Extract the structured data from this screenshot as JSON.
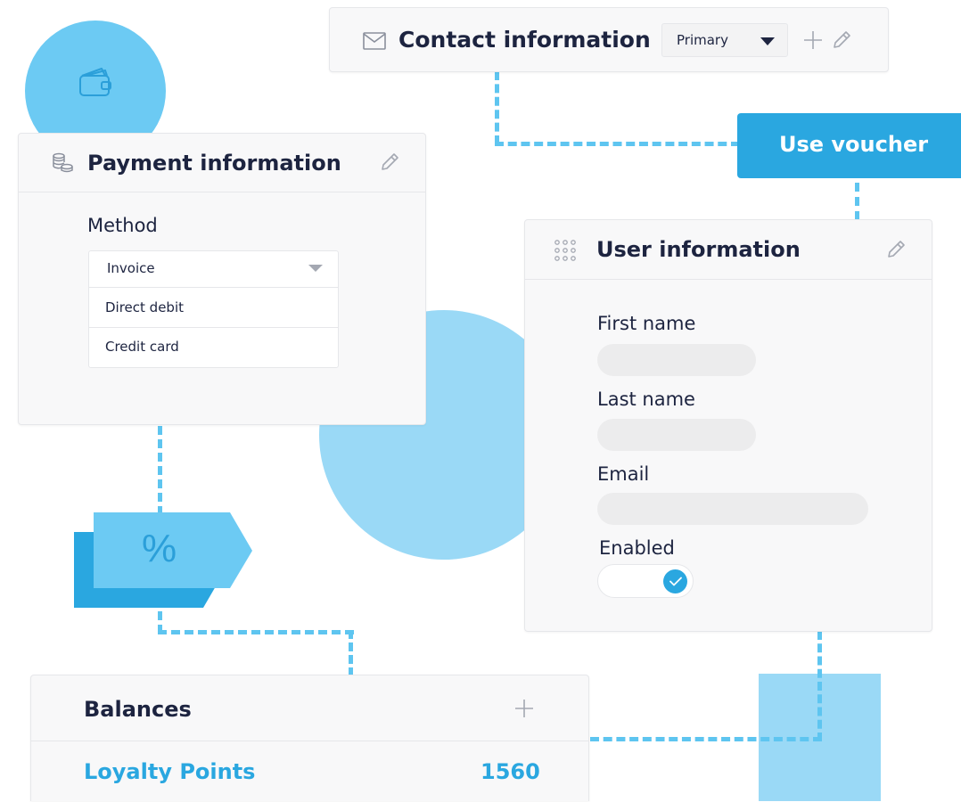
{
  "contact": {
    "title": "Contact information",
    "select_value": "Primary",
    "icons": [
      "envelope-icon",
      "caret-down-icon",
      "plus-icon",
      "pencil-icon"
    ]
  },
  "voucher": {
    "label": "Use voucher"
  },
  "payment": {
    "title": "Payment information",
    "method_label": "Method",
    "options": [
      "Invoice",
      "Direct debit",
      "Credit card"
    ],
    "icons": [
      "coins-icon",
      "pencil-icon",
      "caret-down-icon"
    ]
  },
  "user": {
    "title": "User information",
    "first_name_label": "First name",
    "last_name_label": "Last name",
    "email_label": "Email",
    "enabled_label": "Enabled",
    "enabled": true,
    "icons": [
      "drag-grid-icon",
      "pencil-icon",
      "check-icon"
    ]
  },
  "discount": {
    "symbol": "%"
  },
  "balances": {
    "title": "Balances",
    "rows": [
      {
        "name": "Loyalty Points",
        "value": "1560"
      }
    ],
    "icons": [
      "plus-icon"
    ]
  },
  "decor": {
    "icons": [
      "wallet-icon"
    ]
  },
  "colors": {
    "accent": "#2aa7e0",
    "accent_light": "#5ec5f0",
    "blob": "#9ad9f6",
    "text": "#1d2440"
  }
}
